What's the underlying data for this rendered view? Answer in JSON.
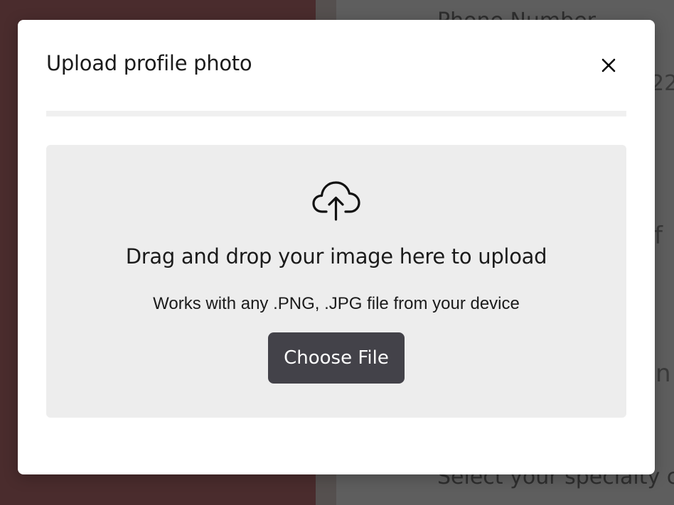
{
  "background": {
    "label_top": "Phone Number",
    "label_bottom": "Select your specialty c",
    "fragment_1": "22",
    "fragment_2": "f",
    "fragment_3": "n"
  },
  "modal": {
    "title": "Upload profile photo",
    "close_icon": "close-icon",
    "dropzone": {
      "icon": "cloud-upload-icon",
      "heading": "Drag and drop your image here to upload",
      "subtext": "Works with any .PNG, .JPG file from your device",
      "button_label": "Choose File"
    }
  },
  "colors": {
    "overlay_left": "#4a2c2d",
    "overlay_right": "#5e5e5e",
    "dropzone_bg": "#ededed",
    "button_bg": "#434249",
    "button_text": "#ffffff"
  }
}
